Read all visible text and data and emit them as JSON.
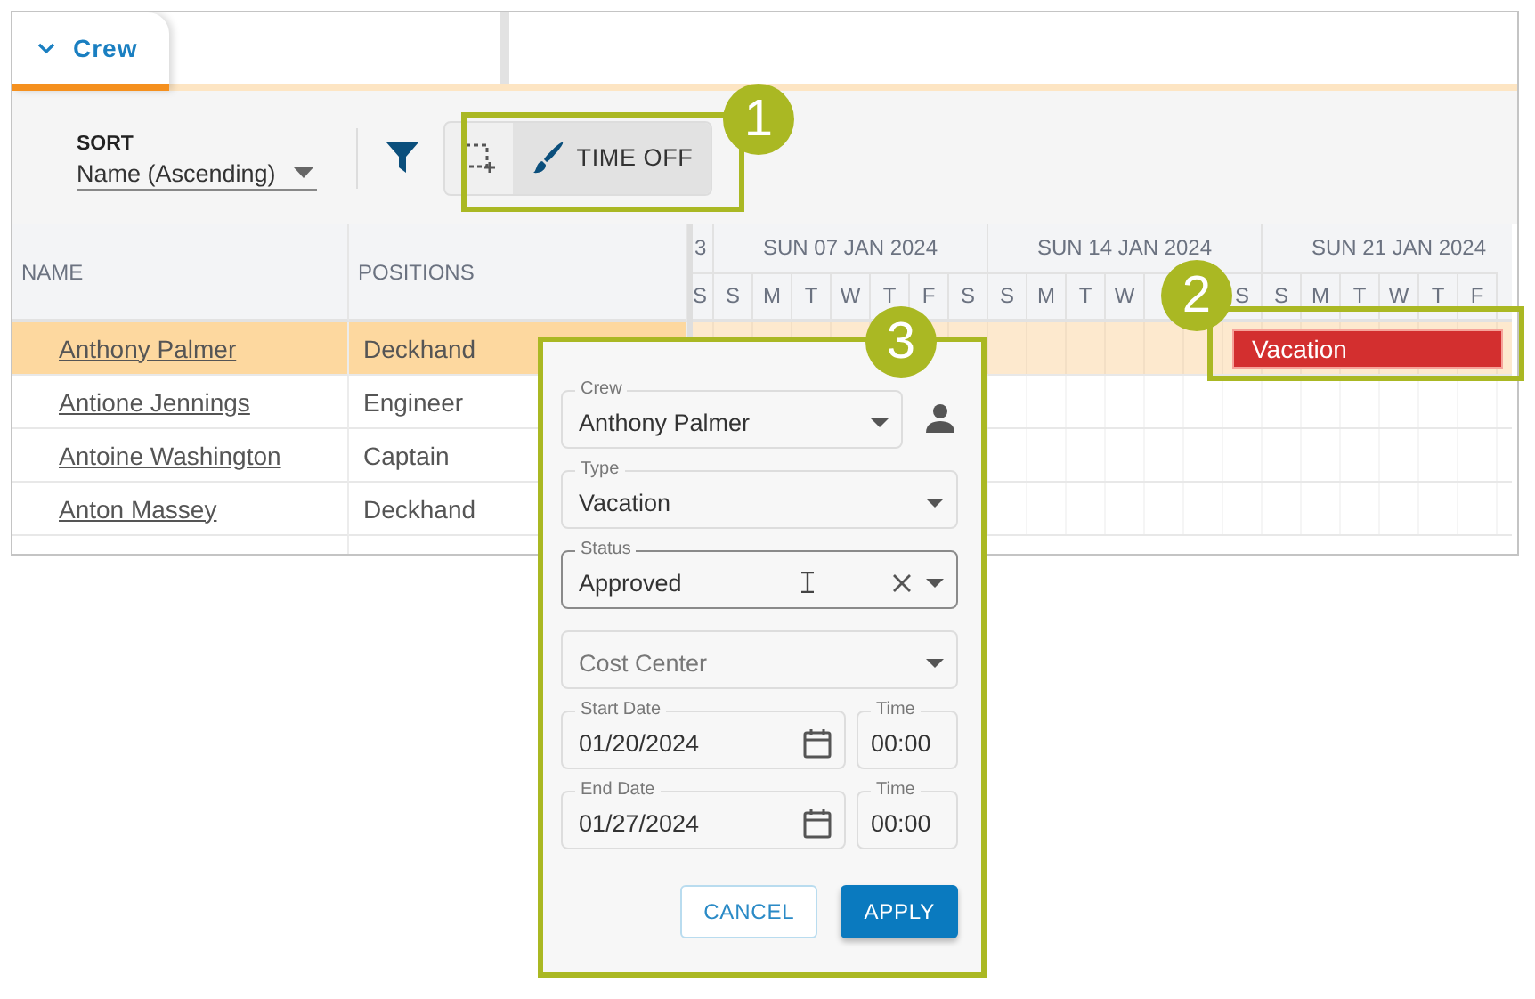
{
  "tab": {
    "label": "Crew"
  },
  "sort": {
    "label": "SORT",
    "value": "Name (Ascending)"
  },
  "mode_buttons": [
    {
      "kind": "select",
      "selected": false
    },
    {
      "kind": "time_off",
      "label": "TIME OFF",
      "selected": true
    }
  ],
  "table": {
    "columns": [
      "NAME",
      "POSITIONS"
    ],
    "rows": [
      {
        "name": "Anthony Palmer",
        "position": "Deckhand",
        "selected": true,
        "events": [
          {
            "label": "Vacation"
          }
        ]
      },
      {
        "name": "Antione Jennings",
        "position": "Engineer",
        "selected": false,
        "events": []
      },
      {
        "name": "Antoine Washington",
        "position": "Captain",
        "selected": false,
        "events": []
      },
      {
        "name": "Anton Massey",
        "position": "Deckhand",
        "selected": false,
        "events": []
      }
    ]
  },
  "timeline": {
    "partial_week": "3",
    "weeks": [
      "SUN 07 JAN 2024",
      "SUN 14 JAN 2024",
      "SUN 21 JAN 2024"
    ],
    "days": [
      {
        "label": "S",
        "covered": false
      },
      {
        "label": "S",
        "covered": false
      },
      {
        "label": "M",
        "covered": false
      },
      {
        "label": "T",
        "covered": false
      },
      {
        "label": "W",
        "covered": false
      },
      {
        "label": "T",
        "covered": false
      },
      {
        "label": "F",
        "covered": false
      },
      {
        "label": "S",
        "covered": false
      },
      {
        "label": "S",
        "covered": false
      },
      {
        "label": "M",
        "covered": false
      },
      {
        "label": "T",
        "covered": false
      },
      {
        "label": "W",
        "covered": false
      },
      {
        "covered": true
      },
      {
        "covered": true
      },
      {
        "label": "S",
        "covered": false
      },
      {
        "label": "S",
        "covered": false
      },
      {
        "label": "M",
        "covered": false
      },
      {
        "label": "T",
        "covered": false
      },
      {
        "label": "W",
        "covered": false
      },
      {
        "label": "T",
        "covered": false
      },
      {
        "label": "F",
        "covered": false
      }
    ]
  },
  "popup": {
    "rows": [
      {
        "fields": [
          {
            "kind": "person_select",
            "label": "Crew",
            "value": "Anthony Palmer",
            "focused": false,
            "clearable": false
          }
        ]
      },
      {
        "fields": [
          {
            "kind": "select",
            "label": "Type",
            "value": "Vacation",
            "focused": false,
            "clearable": false
          }
        ]
      },
      {
        "fields": [
          {
            "kind": "select",
            "label": "Status",
            "value": "Approved",
            "focused": true,
            "clearable": true
          }
        ]
      },
      {
        "fields": [
          {
            "kind": "select",
            "placeholder": "Cost Center",
            "focused": false,
            "clearable": false
          }
        ]
      },
      {
        "fields": [
          {
            "kind": "date",
            "label": "Start Date",
            "value": "01/20/2024",
            "focused": false
          },
          {
            "kind": "time",
            "label": "Time",
            "value": "00:00",
            "focused": false
          }
        ]
      },
      {
        "fields": [
          {
            "kind": "date",
            "label": "End Date",
            "value": "01/27/2024",
            "focused": false
          },
          {
            "kind": "time",
            "label": "Time",
            "value": "00:00",
            "focused": false
          }
        ]
      }
    ],
    "buttons": [
      {
        "kind": "secondary",
        "label": "CANCEL"
      },
      {
        "kind": "primary",
        "label": "APPLY"
      }
    ]
  },
  "callouts": [
    "1",
    "2",
    "3"
  ]
}
